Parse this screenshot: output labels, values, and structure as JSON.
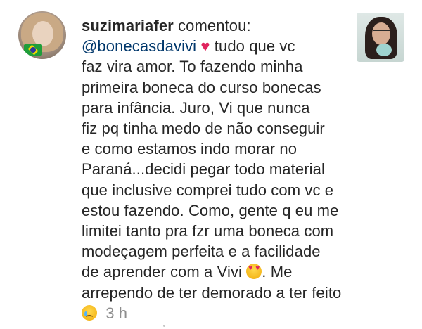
{
  "comment": {
    "username": "suzimariafer",
    "action": "comentou:",
    "mention": "@bonecasdavivi",
    "heart_icon": "♥",
    "lines": [
      "tudo que vc",
      "faz vira amor. To fazendo minha",
      "primeira boneca do curso bonecas",
      "para infância. Juro, Vi que nunca",
      "fiz pq tinha medo de não conseguir",
      "e como estamos indo morar no",
      "Paraná...decidi pegar todo material",
      "que inclusive comprei tudo com vc e",
      "estou fazendo. Como, gente q eu me",
      "limitei tanto pra fzr uma boneca com",
      "modeçagem perfeita e a facilidade",
      "de aprender com a Vivi",
      ". Me",
      "arrependo de ter demorado a ter feito"
    ],
    "emoji_love": "smiling-face-with-heart-eyes",
    "emoji_cry": "crying-face",
    "timestamp": "3 h"
  },
  "colors": {
    "text": "#262626",
    "mention": "#00376b",
    "heart": "#e0245e",
    "timestamp": "#8e8e8e"
  }
}
